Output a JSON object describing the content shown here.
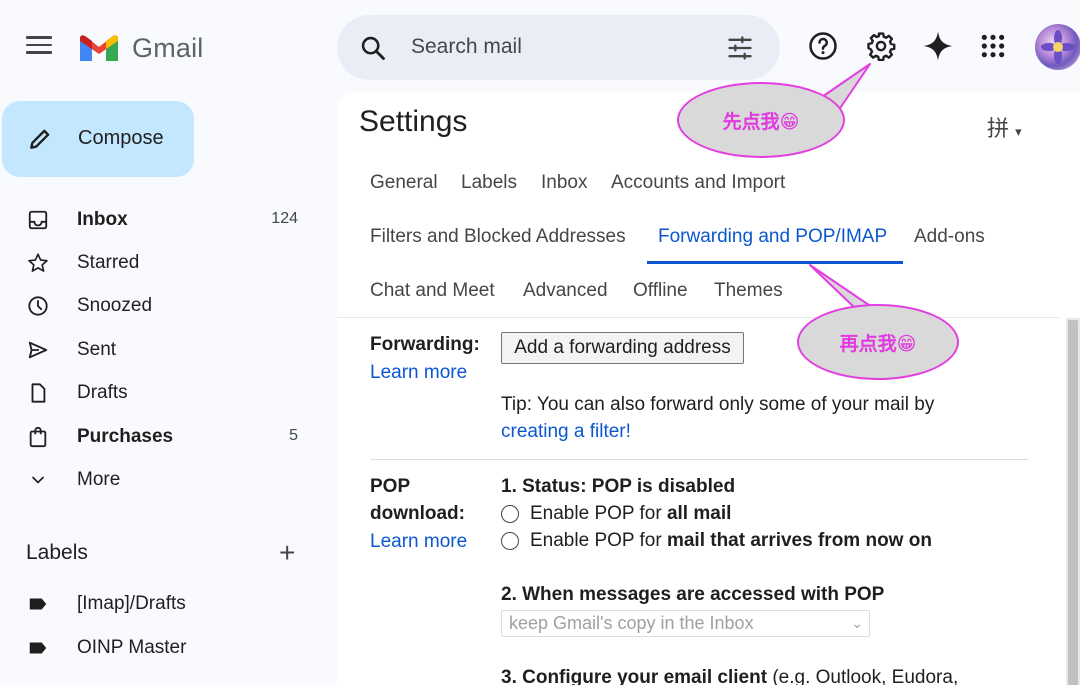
{
  "header": {
    "app_name": "Gmail",
    "search_placeholder": "Search mail"
  },
  "sidebar": {
    "compose_label": "Compose",
    "items": [
      {
        "label": "Inbox",
        "count": "124",
        "icon": "inbox-icon",
        "bold": true
      },
      {
        "label": "Starred",
        "count": "",
        "icon": "star-icon",
        "bold": false
      },
      {
        "label": "Snoozed",
        "count": "",
        "icon": "clock-icon",
        "bold": false
      },
      {
        "label": "Sent",
        "count": "",
        "icon": "send-icon",
        "bold": false
      },
      {
        "label": "Drafts",
        "count": "",
        "icon": "draft-icon",
        "bold": false
      },
      {
        "label": "Purchases",
        "count": "5",
        "icon": "shopping-bag-icon",
        "bold": true
      },
      {
        "label": "More",
        "count": "",
        "icon": "chevron-down-icon",
        "bold": false
      }
    ],
    "labels_title": "Labels",
    "labels_add": "+",
    "labels": [
      {
        "label": "[Imap]/Drafts",
        "icon": "label-icon"
      },
      {
        "label": "OINP Master",
        "icon": "label-icon"
      }
    ]
  },
  "settings": {
    "title": "Settings",
    "input_tool": "拼",
    "tabs": [
      {
        "label": "General",
        "active": false
      },
      {
        "label": "Labels",
        "active": false
      },
      {
        "label": "Inbox",
        "active": false
      },
      {
        "label": "Accounts and Import",
        "active": false
      },
      {
        "label": "Filters and Blocked Addresses",
        "active": false
      },
      {
        "label": "Forwarding and POP/IMAP",
        "active": true
      },
      {
        "label": "Add-ons",
        "active": false
      },
      {
        "label": "Chat and Meet",
        "active": false
      },
      {
        "label": "Advanced",
        "active": false
      },
      {
        "label": "Offline",
        "active": false
      },
      {
        "label": "Themes",
        "active": false
      }
    ],
    "forwarding": {
      "label": "Forwarding:",
      "learn_more": "Learn more",
      "button": "Add a forwarding address",
      "tip_prefix": "Tip: You can also forward only some of your mail by",
      "tip_link": "creating a filter!"
    },
    "pop": {
      "label_line1": "POP",
      "label_line2": "download:",
      "learn_more": "Learn more",
      "status": "1. Status: POP is disabled",
      "option1_prefix": "Enable POP for ",
      "option1_bold": "all mail",
      "option2_prefix": "Enable POP for ",
      "option2_bold": "mail that arrives from now on",
      "step2_title": "2. When messages are accessed with POP",
      "step2_select": "keep Gmail's copy in the Inbox",
      "step3_bold": "3. Configure your email client",
      "step3_rest": " (e.g. Outlook, Eudora,"
    }
  },
  "annotations": {
    "callout1": "先点我😁",
    "callout2": "再点我😁",
    "callout_color": "#e23ee0"
  },
  "colors": {
    "accent": "#0b57d0",
    "compose_bg": "#c2e7ff",
    "search_bg": "#e9eef6"
  }
}
